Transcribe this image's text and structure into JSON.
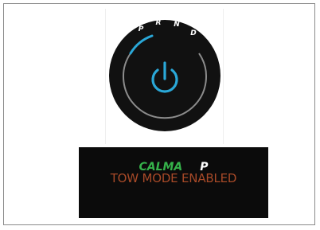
{
  "gear_selector": {
    "gears": [
      "P",
      "R",
      "N",
      "D"
    ],
    "selected_gear": "P",
    "power_icon": "power-icon",
    "accent_color": "#2aa8d8"
  },
  "display": {
    "drive_mode": "CALMA",
    "gear": "P",
    "message": "TOW MODE ENABLED",
    "colors": {
      "drive_mode": "#35b24a",
      "gear": "#ffffff",
      "message": "#a84a28"
    }
  }
}
